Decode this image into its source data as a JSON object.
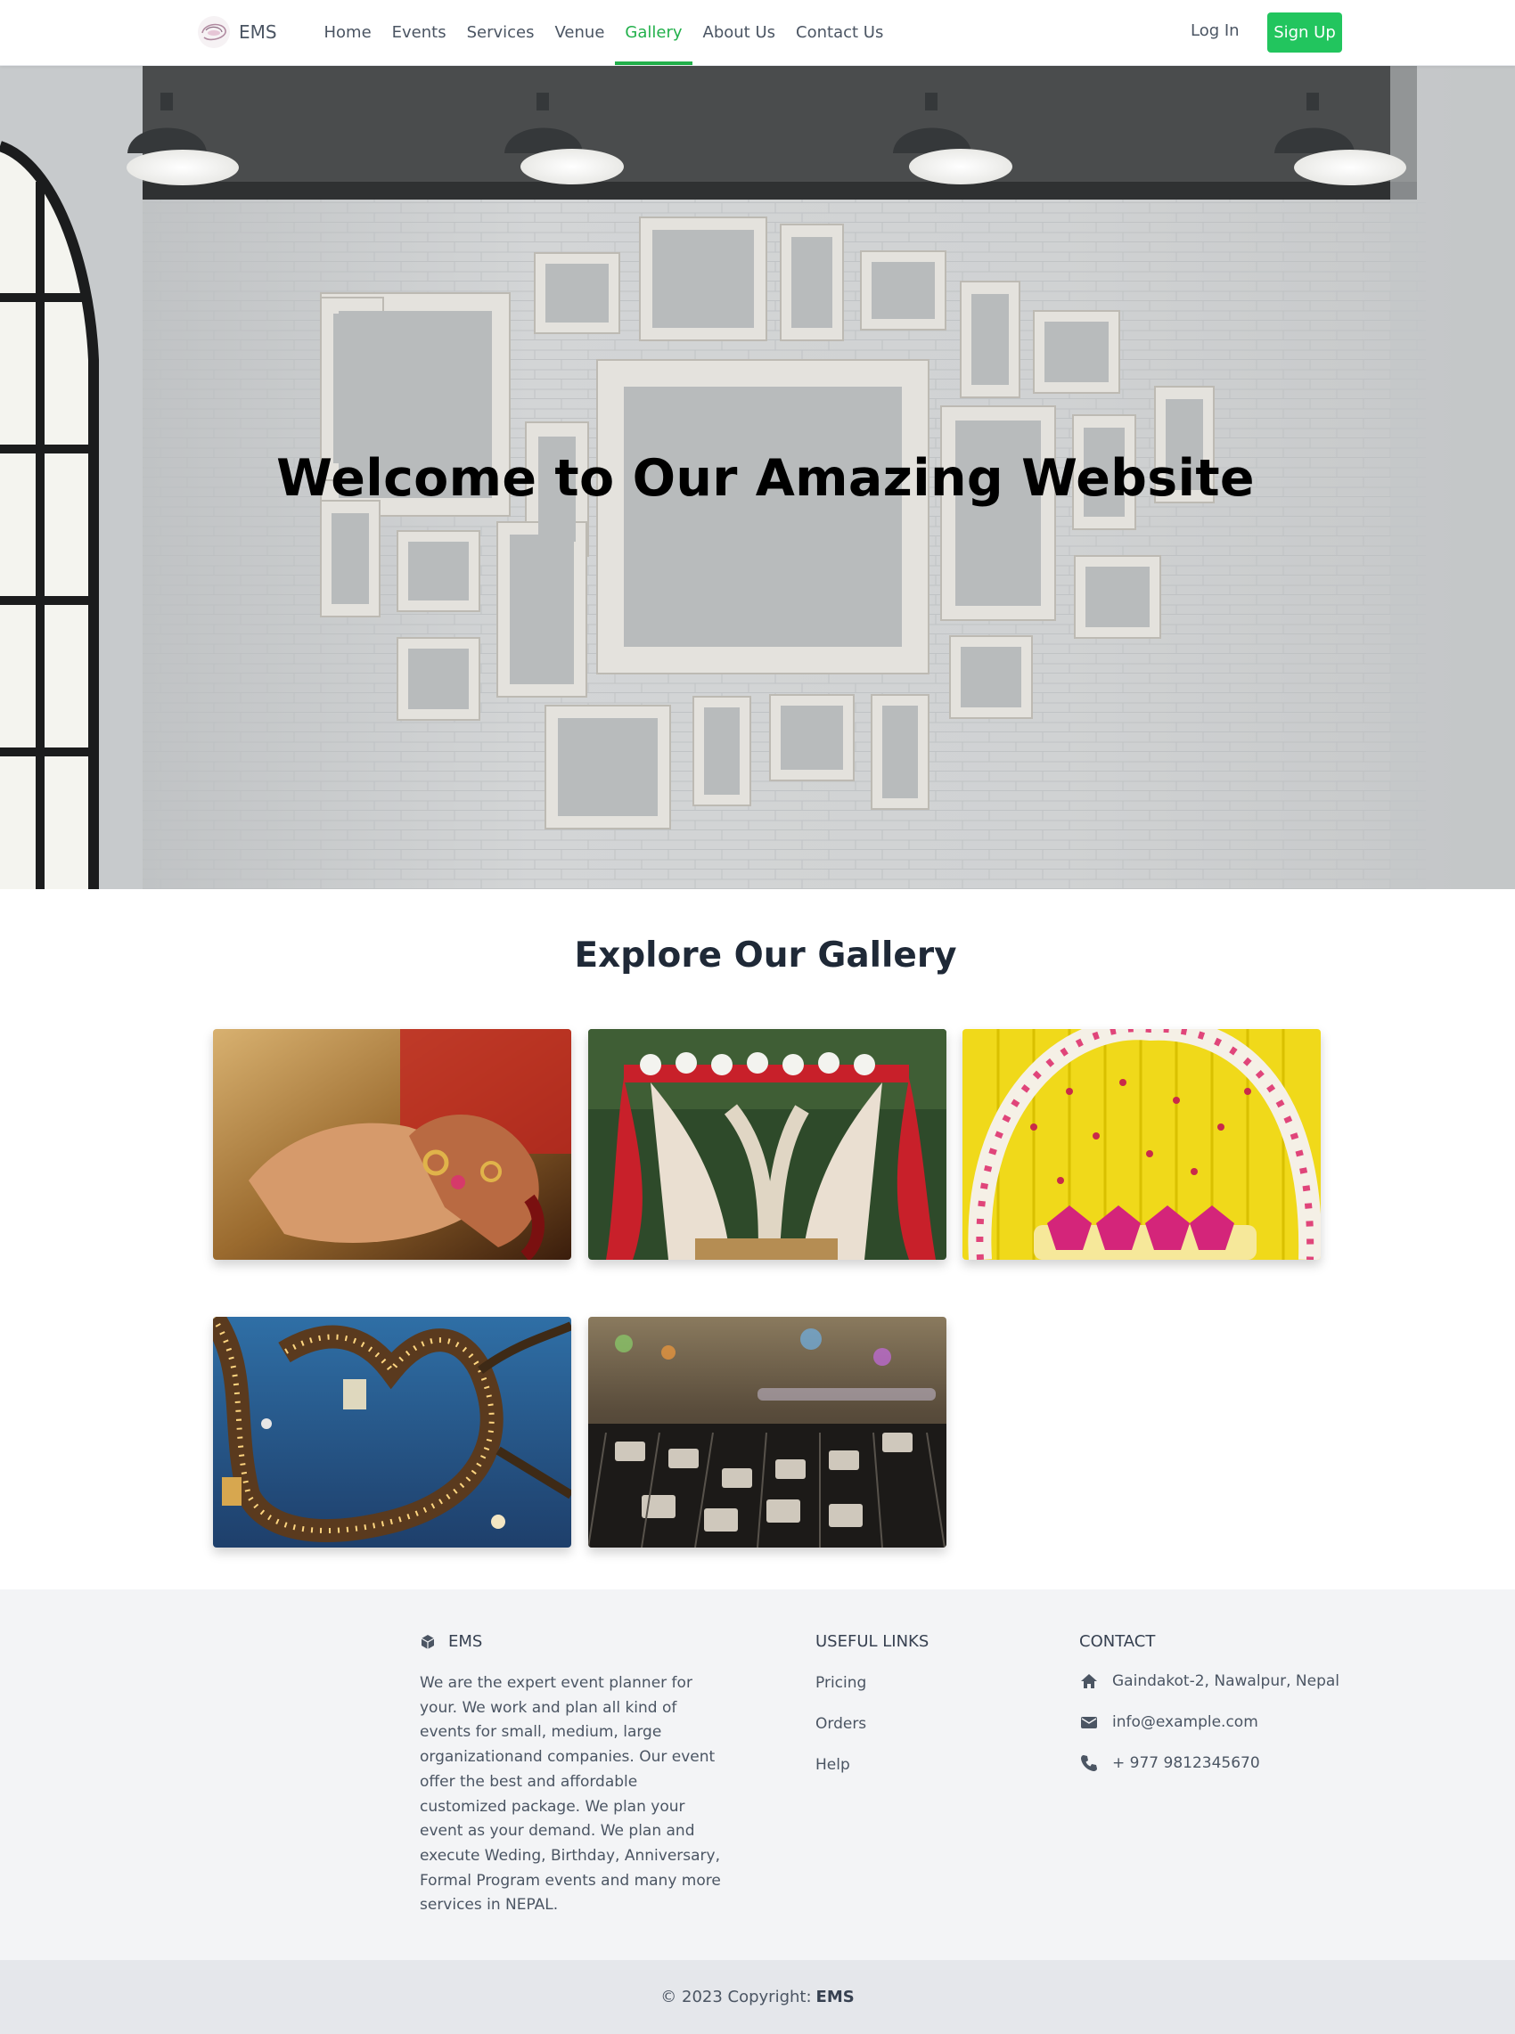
{
  "nav": {
    "brand": "EMS",
    "links": [
      "Home",
      "Events",
      "Services",
      "Venue",
      "Gallery",
      "About Us",
      "Contact Us"
    ],
    "active_link": "Gallery",
    "login_label": "Log In",
    "signup_label": "Sign Up",
    "accent_color": "#22c55e"
  },
  "hero": {
    "title": "Welcome to Our Amazing Website"
  },
  "gallery": {
    "title": "Explore Our Gallery",
    "images": [
      "wedding-hands-rings-photo",
      "wedding-mandap-red-drapes-photo",
      "yellow-flower-arch-stage-photo",
      "tree-lights-lanterns-photo",
      "audio-mixer-console-photo"
    ]
  },
  "footer": {
    "brand": "EMS",
    "description": "We are the expert event planner for your. We work and plan all kind of events for small, medium, large organizationand companies. Our event offer the best and affordable customized package. We plan your event as your demand. We plan and execute Weding, Birthday, Anniversary, Formal Program events and many more services in NEPAL.",
    "useful_links_heading": "Useful links",
    "useful_links": [
      "Pricing",
      "Orders",
      "Help"
    ],
    "contact_heading": "Contact",
    "contact": {
      "address": "Gaindakot-2, Nawalpur, Nepal",
      "email": "info@example.com",
      "phone": "+ 977 9812345670"
    },
    "copyright_prefix": "© 2023 Copyright:",
    "copyright_brand": "EMS"
  }
}
